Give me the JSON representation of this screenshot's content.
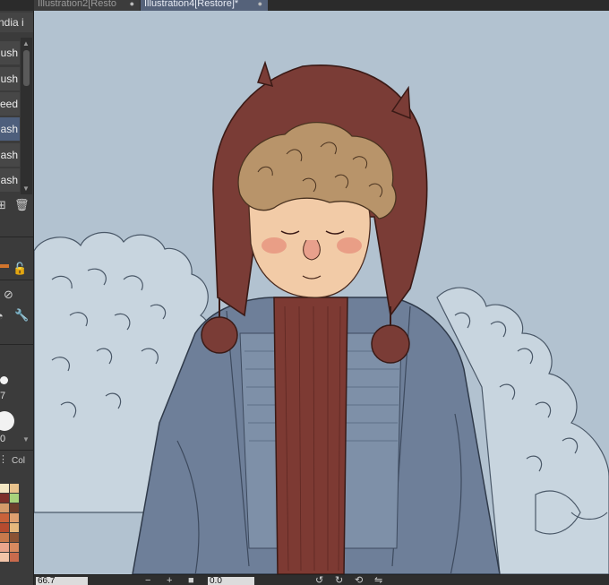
{
  "tabs": [
    {
      "label": "Illustration2[Resto",
      "close": "●"
    },
    {
      "label": "Illustration4[Restore]*",
      "close": "●"
    }
  ],
  "left_panel": {
    "header_label": "ndia i",
    "brushes": [
      {
        "label": "ush",
        "selected": false
      },
      {
        "label": "ush",
        "selected": false
      },
      {
        "label": "eed",
        "selected": false
      },
      {
        "label": "ash",
        "selected": true
      },
      {
        "label": "ash",
        "selected": false
      },
      {
        "label": "ash",
        "selected": false
      }
    ],
    "brush_size_value": "7",
    "opacity_value": "0",
    "color_panel_label": "Col"
  },
  "icons": {
    "add": "add-icon",
    "trash": "trash-icon",
    "lock": "lock-icon",
    "wrench": "wrench-icon",
    "eraser": "eraser-icon",
    "history": "history-icon"
  },
  "palette": [
    "#f4e7c4",
    "#e8c28c",
    "#7d2f2a",
    "#a8d27c",
    "#d59b6a",
    "#6b3d2c",
    "#c9623a",
    "#e0a070",
    "#b54b2f",
    "#e6b87d",
    "#c8794c",
    "#8a5234",
    "#eaa58c",
    "#d98a5f",
    "#f2c4a8",
    "#c96b4d"
  ],
  "bottom_bar": {
    "zoom": "66.7",
    "minus": "−",
    "plus": "+",
    "angle": "0.0",
    "rotate_left": "↺",
    "rotate_right": "↻",
    "reset": "⟲",
    "flip": "⇋"
  },
  "colors": {
    "canvas_bg": "#b2c2d0",
    "hat": "#7a3c36",
    "coat": "#6e7f99",
    "scarf": "#7d3a33",
    "hair": "#b8946a",
    "skin": "#f2cba7",
    "selection": "#4e5f7c"
  }
}
